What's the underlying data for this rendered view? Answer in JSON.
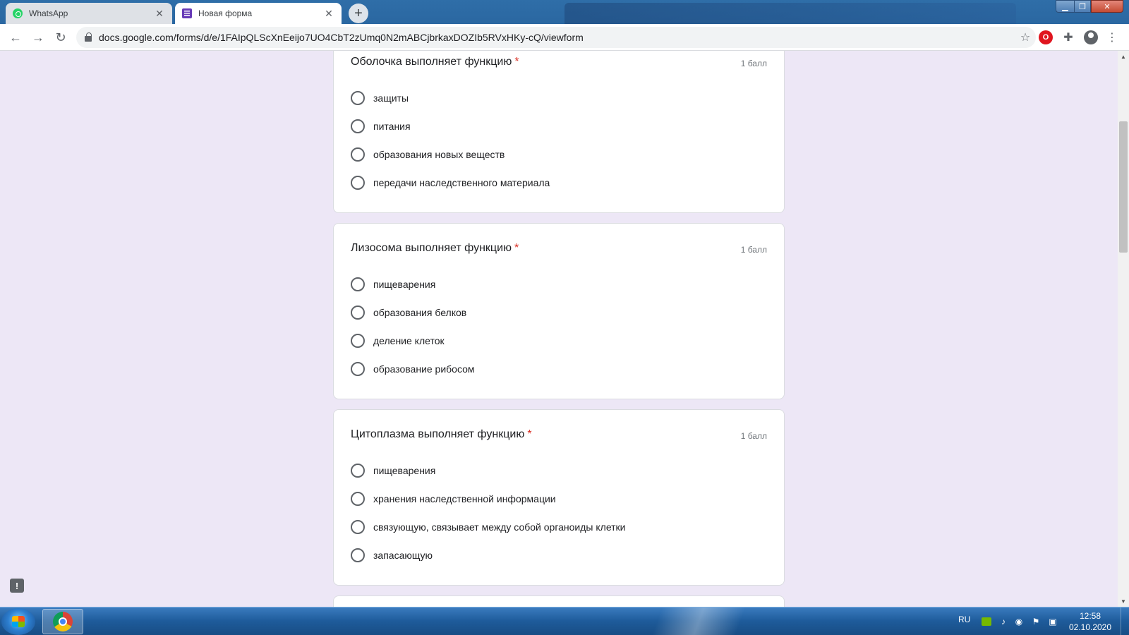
{
  "browser": {
    "tabs": [
      {
        "label": "WhatsApp",
        "icon": "whatsapp-icon",
        "active": false
      },
      {
        "label": "Новая форма",
        "icon": "google-forms-icon",
        "active": true
      }
    ],
    "url": "docs.google.com/forms/d/e/1FAIpQLScXnEeijo7UO4CbT2zUmq0N2mABCjbrkaxDOZIb5RVxHKy-cQ/viewform"
  },
  "form": {
    "questions": [
      {
        "title": "Оболочка выполняет функцию",
        "required_mark": "*",
        "points": "1 балл",
        "options": [
          "защиты",
          "питания",
          "образования новых веществ",
          "передачи наследственного материала"
        ]
      },
      {
        "title": "Лизосома выполняет функцию",
        "required_mark": "*",
        "points": "1 балл",
        "options": [
          "пищеварения",
          "образования белков",
          "деление клеток",
          "образование рибосом"
        ]
      },
      {
        "title": "Цитоплазма выполняет функцию",
        "required_mark": "*",
        "points": "1 балл",
        "options": [
          "пищеварения",
          "хранения наследственной информации",
          "связующую, связывает между собой органоиды клетки",
          "запасающую"
        ]
      }
    ]
  },
  "taskbar": {
    "language": "RU",
    "time": "12:58",
    "date": "02.10.2020"
  },
  "colors": {
    "page_background": "#ede7f6",
    "forms_accent": "#673ab7",
    "required": "#d93025"
  }
}
